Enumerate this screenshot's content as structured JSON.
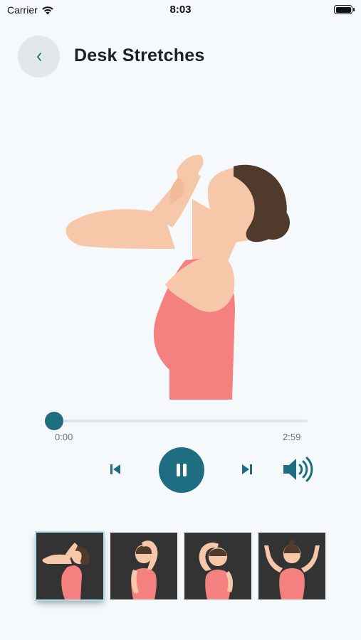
{
  "status_bar": {
    "carrier": "Carrier",
    "time": "8:03"
  },
  "header": {
    "title": "Desk Stretches",
    "back_icon": "chevron-left-icon"
  },
  "player": {
    "elapsed": "0:00",
    "total": "2:59",
    "progress": 0.0,
    "playing": true
  },
  "controls": {
    "previous_icon": "skip-previous-icon",
    "pause_icon": "pause-icon",
    "next_icon": "skip-next-icon",
    "volume_icon": "volume-icon"
  },
  "thumbnails": [
    {
      "pose": "neck-stretch-head-back",
      "selected": true
    },
    {
      "pose": "overhead-arm-stretch",
      "selected": false
    },
    {
      "pose": "head-side-tilt",
      "selected": false
    },
    {
      "pose": "arms-raised",
      "selected": false
    }
  ],
  "colors": {
    "background": "#f5f9fc",
    "accent": "#1e6d80",
    "skin": "#f6c8a9",
    "hair": "#4f3a2c",
    "top": "#f58080",
    "thumb_bg": "#333333",
    "selected_outline": "#a8e2ef"
  }
}
